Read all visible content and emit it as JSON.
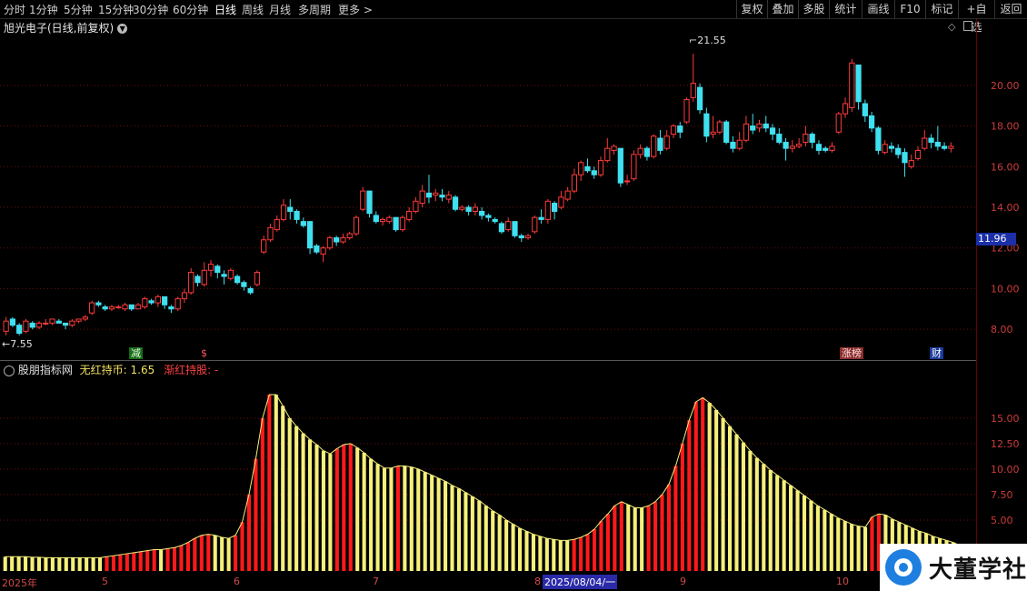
{
  "toolbar": {
    "periods": [
      "分时",
      "1分钟",
      "5分钟",
      "15分钟",
      "30分钟",
      "60分钟",
      "日线",
      "周线",
      "月线",
      "多周期",
      "更多 >"
    ],
    "active_period": "日线",
    "right_buttons": [
      "复权",
      "叠加",
      "多股",
      "统计",
      "画线",
      "F10",
      "标记",
      "+自选",
      "返回"
    ]
  },
  "chart_title": "旭光电子(日线,前复权)",
  "indicator": {
    "name": "股朋指标网",
    "line1_label": "无红持币: 1.65",
    "line2_label": "渐红持股: -"
  },
  "annotations": {
    "high_label": "21.55",
    "low_label": "7.55",
    "current_price": "11.96"
  },
  "flags": [
    "减",
    "$",
    "涨榜",
    "财"
  ],
  "date_tooltip": "2025/08/04/一",
  "logo_text": "大董学社",
  "colors": {
    "up": "#ff3b3b",
    "down": "#3fe0f0",
    "hist_red": "#ff1a1a",
    "hist_yellow": "#f5f07a"
  },
  "chart_data": [
    {
      "type": "candlestick",
      "title": "旭光电子(日线,前复权)",
      "ylim": [
        7.2,
        22.5
      ],
      "y_ticks": [
        "8.00",
        "10.00",
        "12.00",
        "14.00",
        "16.00",
        "18.00",
        "20.00"
      ],
      "x_ticks": [
        "2025年",
        "5",
        "6",
        "7",
        "8",
        "9",
        "10"
      ],
      "candles": [
        [
          7.9,
          8.4,
          8.6,
          7.7
        ],
        [
          8.5,
          8.2,
          8.6,
          8.1
        ],
        [
          8.2,
          7.8,
          8.3,
          7.7
        ],
        [
          7.9,
          8.4,
          8.5,
          7.8
        ],
        [
          8.3,
          8.1,
          8.4,
          8.0
        ],
        [
          8.1,
          8.3,
          8.4,
          8.0
        ],
        [
          8.3,
          8.3,
          8.5,
          8.2
        ],
        [
          8.3,
          8.5,
          8.5,
          8.2
        ],
        [
          8.4,
          8.3,
          8.5,
          8.3
        ],
        [
          8.3,
          8.2,
          8.3,
          8.0
        ],
        [
          8.2,
          8.4,
          8.5,
          8.1
        ],
        [
          8.4,
          8.5,
          8.5,
          8.3
        ],
        [
          8.5,
          8.6,
          8.7,
          8.4
        ],
        [
          8.8,
          9.3,
          9.4,
          8.7
        ],
        [
          9.3,
          9.2,
          9.4,
          9.1
        ],
        [
          9.1,
          9.0,
          9.2,
          8.9
        ],
        [
          9.0,
          9.1,
          9.2,
          8.9
        ],
        [
          9.1,
          9.1,
          9.2,
          9.0
        ],
        [
          9.0,
          9.2,
          9.3,
          8.9
        ],
        [
          9.2,
          9.0,
          9.2,
          8.9
        ],
        [
          9.0,
          9.2,
          9.3,
          9.0
        ],
        [
          9.1,
          9.5,
          9.6,
          9.0
        ],
        [
          9.4,
          9.3,
          9.5,
          9.2
        ],
        [
          9.3,
          9.6,
          9.7,
          9.1
        ],
        [
          9.6,
          9.2,
          9.6,
          9.0
        ],
        [
          9.1,
          9.0,
          9.2,
          8.8
        ],
        [
          9.0,
          9.5,
          9.6,
          8.9
        ],
        [
          9.5,
          9.8,
          10.0,
          9.3
        ],
        [
          9.8,
          10.8,
          11.0,
          9.7
        ],
        [
          10.6,
          10.3,
          10.7,
          10.1
        ],
        [
          10.2,
          10.9,
          11.3,
          10.1
        ],
        [
          10.9,
          11.2,
          11.4,
          10.6
        ],
        [
          11.1,
          10.8,
          11.2,
          10.5
        ],
        [
          10.7,
          10.6,
          10.9,
          10.2
        ],
        [
          10.5,
          10.9,
          11.0,
          10.4
        ],
        [
          10.6,
          10.3,
          10.7,
          10.2
        ],
        [
          10.3,
          10.1,
          10.4,
          9.9
        ],
        [
          10.0,
          9.8,
          10.1,
          9.7
        ],
        [
          10.2,
          10.8,
          10.9,
          10.1
        ],
        [
          11.8,
          12.4,
          12.6,
          11.7
        ],
        [
          12.4,
          13.0,
          13.2,
          12.3
        ],
        [
          12.9,
          13.4,
          13.6,
          12.8
        ],
        [
          13.4,
          14.1,
          14.4,
          13.3
        ],
        [
          14.0,
          13.8,
          14.4,
          13.4
        ],
        [
          13.8,
          13.4,
          13.9,
          13.2
        ],
        [
          13.3,
          13.1,
          13.5,
          13.0
        ],
        [
          13.3,
          12.0,
          13.3,
          11.7
        ],
        [
          12.1,
          11.8,
          12.2,
          11.7
        ],
        [
          11.7,
          12.0,
          12.1,
          11.3
        ],
        [
          12.0,
          12.5,
          12.6,
          11.9
        ],
        [
          12.5,
          12.3,
          12.6,
          12.1
        ],
        [
          12.3,
          12.5,
          12.7,
          12.2
        ],
        [
          12.5,
          12.7,
          12.8,
          12.4
        ],
        [
          12.7,
          13.5,
          13.6,
          12.6
        ],
        [
          13.9,
          14.8,
          15.0,
          13.8
        ],
        [
          14.8,
          13.7,
          14.8,
          13.5
        ],
        [
          13.6,
          13.3,
          13.8,
          13.2
        ],
        [
          13.3,
          13.4,
          13.5,
          13.1
        ],
        [
          13.3,
          13.5,
          13.6,
          13.2
        ],
        [
          13.5,
          12.9,
          13.5,
          12.8
        ],
        [
          12.9,
          13.5,
          13.6,
          12.8
        ],
        [
          13.4,
          13.8,
          14.0,
          13.3
        ],
        [
          13.8,
          14.3,
          14.5,
          13.7
        ],
        [
          14.2,
          14.8,
          15.1,
          14.0
        ],
        [
          14.7,
          14.5,
          15.6,
          14.2
        ],
        [
          14.6,
          14.7,
          14.9,
          14.3
        ],
        [
          14.6,
          14.5,
          14.9,
          14.3
        ],
        [
          14.4,
          14.6,
          14.8,
          14.2
        ],
        [
          14.5,
          13.9,
          14.6,
          13.8
        ],
        [
          13.9,
          14.0,
          14.1,
          13.8
        ],
        [
          14.0,
          13.8,
          14.1,
          13.6
        ],
        [
          13.8,
          14.0,
          14.2,
          13.6
        ],
        [
          13.8,
          13.6,
          14.0,
          13.4
        ],
        [
          13.6,
          13.5,
          13.7,
          13.3
        ],
        [
          13.4,
          13.3,
          13.5,
          13.2
        ],
        [
          13.2,
          12.8,
          13.3,
          12.7
        ],
        [
          12.9,
          13.3,
          13.5,
          12.8
        ],
        [
          13.3,
          12.6,
          13.3,
          12.5
        ],
        [
          12.6,
          12.5,
          12.7,
          12.3
        ],
        [
          12.5,
          12.6,
          12.7,
          12.4
        ],
        [
          12.8,
          13.5,
          13.6,
          12.7
        ],
        [
          13.5,
          13.4,
          13.9,
          13.2
        ],
        [
          13.4,
          14.3,
          14.4,
          13.2
        ],
        [
          14.2,
          13.8,
          14.3,
          13.4
        ],
        [
          14.0,
          14.5,
          14.8,
          13.9
        ],
        [
          14.4,
          14.8,
          15.0,
          14.3
        ],
        [
          14.8,
          15.6,
          15.9,
          14.7
        ],
        [
          15.6,
          16.2,
          16.3,
          15.3
        ],
        [
          16.0,
          15.8,
          16.4,
          15.7
        ],
        [
          15.8,
          15.6,
          16.0,
          15.4
        ],
        [
          15.6,
          16.3,
          16.5,
          15.5
        ],
        [
          16.3,
          16.9,
          17.4,
          16.2
        ],
        [
          16.8,
          17.0,
          17.1,
          16.6
        ],
        [
          16.9,
          15.2,
          16.9,
          15.0
        ],
        [
          15.3,
          15.3,
          15.6,
          15.1
        ],
        [
          15.4,
          16.6,
          16.8,
          15.3
        ],
        [
          16.6,
          16.9,
          17.1,
          16.4
        ],
        [
          16.9,
          16.5,
          17.0,
          16.3
        ],
        [
          16.5,
          17.5,
          17.6,
          16.4
        ],
        [
          17.4,
          16.8,
          17.8,
          16.6
        ],
        [
          16.9,
          17.5,
          17.8,
          16.8
        ],
        [
          17.6,
          18.0,
          18.1,
          17.4
        ],
        [
          18.0,
          17.7,
          18.2,
          17.4
        ],
        [
          18.2,
          19.3,
          19.4,
          18.1
        ],
        [
          19.4,
          20.1,
          21.55,
          19.2
        ],
        [
          19.9,
          18.8,
          20.1,
          18.6
        ],
        [
          18.6,
          17.5,
          18.9,
          17.2
        ],
        [
          17.6,
          17.7,
          18.5,
          17.4
        ],
        [
          17.7,
          18.2,
          18.3,
          17.6
        ],
        [
          18.2,
          17.2,
          18.3,
          17.1
        ],
        [
          17.2,
          16.9,
          17.5,
          16.7
        ],
        [
          16.9,
          17.3,
          17.7,
          16.8
        ],
        [
          17.3,
          18.1,
          18.5,
          17.2
        ],
        [
          18.0,
          17.8,
          18.6,
          17.6
        ],
        [
          17.9,
          18.1,
          18.3,
          17.7
        ],
        [
          18.1,
          17.9,
          18.5,
          17.7
        ],
        [
          17.9,
          17.6,
          18.1,
          17.3
        ],
        [
          17.6,
          17.2,
          17.9,
          17.1
        ],
        [
          17.2,
          16.9,
          17.4,
          16.3
        ],
        [
          16.9,
          17.0,
          17.3,
          16.7
        ],
        [
          17.0,
          17.1,
          17.4,
          16.9
        ],
        [
          17.2,
          17.6,
          18.0,
          17.0
        ],
        [
          17.6,
          17.2,
          17.7,
          16.9
        ],
        [
          17.1,
          16.8,
          17.3,
          16.6
        ],
        [
          16.9,
          16.8,
          17.0,
          16.7
        ],
        [
          16.8,
          17.0,
          17.2,
          16.7
        ],
        [
          17.7,
          18.6,
          18.7,
          17.6
        ],
        [
          18.6,
          19.1,
          19.4,
          18.4
        ],
        [
          18.9,
          21.1,
          21.3,
          18.7
        ],
        [
          21.0,
          19.2,
          21.0,
          18.8
        ],
        [
          19.1,
          18.5,
          19.3,
          18.2
        ],
        [
          18.5,
          17.9,
          18.7,
          17.7
        ],
        [
          17.9,
          16.8,
          18.0,
          16.6
        ],
        [
          16.7,
          17.1,
          17.3,
          16.6
        ],
        [
          17.0,
          16.9,
          17.2,
          16.7
        ],
        [
          16.9,
          16.6,
          17.1,
          16.4
        ],
        [
          16.7,
          16.2,
          16.9,
          15.5
        ],
        [
          16.0,
          16.3,
          16.6,
          15.9
        ],
        [
          16.4,
          16.8,
          17.0,
          16.3
        ],
        [
          16.9,
          17.4,
          17.8,
          16.8
        ],
        [
          17.4,
          17.2,
          17.6,
          16.9
        ],
        [
          17.2,
          17.0,
          18.0,
          16.8
        ],
        [
          17.0,
          16.9,
          17.2,
          16.8
        ],
        [
          16.9,
          17.0,
          17.2,
          16.7
        ]
      ]
    },
    {
      "type": "bar",
      "title": "股朋指标网",
      "ylim": [
        0,
        19
      ],
      "y_ticks": [
        "5.00",
        "7.50",
        "10.00",
        "12.50",
        "15.00"
      ],
      "series": [
        {
          "name": "无红持币",
          "values": [
            1.4,
            1.4,
            1.4,
            1.4,
            1.35,
            1.35,
            1.3,
            1.3,
            1.3,
            1.3,
            1.3,
            1.3,
            1.3,
            1.3,
            1.3,
            1.4,
            1.5,
            1.6,
            1.7,
            1.8,
            1.9,
            2.0,
            2.1,
            2.1,
            2.2,
            2.3,
            2.5,
            2.8,
            3.2,
            3.5,
            3.6,
            3.5,
            3.3,
            3.2,
            3.5,
            4.8,
            7.5,
            11.0,
            15.0,
            17.3,
            17.3,
            16.2,
            15.0,
            14.2,
            13.5,
            12.9,
            12.4,
            11.8,
            11.5,
            12.0,
            12.4,
            12.5,
            12.1,
            11.6,
            11.0,
            10.5,
            10.1,
            10.1,
            10.3,
            10.3,
            10.2,
            10.0,
            9.7,
            9.4,
            9.1,
            8.8,
            8.4,
            8.1,
            7.7,
            7.3,
            6.9,
            6.4,
            5.9,
            5.5,
            5.0,
            4.6,
            4.2,
            3.9,
            3.6,
            3.4,
            3.2,
            3.1,
            3.0,
            3.0,
            3.1,
            3.3,
            3.6,
            4.1,
            4.9,
            5.6,
            6.4,
            6.8,
            6.5,
            6.2,
            6.2,
            6.4,
            6.8,
            7.5,
            8.5,
            10.3,
            12.5,
            14.8,
            16.6,
            17.0,
            16.5,
            15.8,
            15.0,
            14.2,
            13.4,
            12.6,
            11.8,
            11.1,
            10.5,
            9.9,
            9.4,
            8.9,
            8.4,
            7.9,
            7.4,
            6.9,
            6.4,
            6.0,
            5.6,
            5.2,
            4.9,
            4.6,
            4.4,
            4.3,
            5.3,
            5.6,
            5.5,
            5.1,
            4.8,
            4.5,
            4.2,
            3.9,
            3.7,
            3.4,
            3.2,
            3.0,
            2.8,
            2.5,
            2.3,
            2.2
          ]
        }
      ]
    }
  ]
}
